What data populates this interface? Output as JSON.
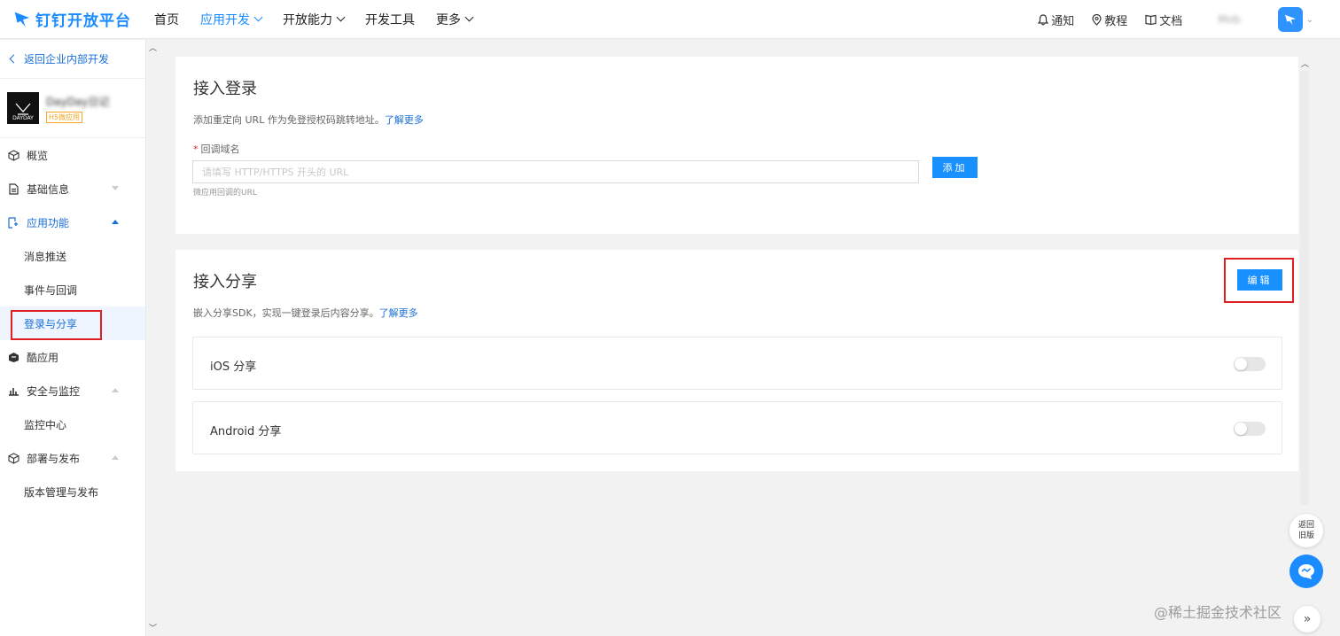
{
  "topbar": {
    "logo_text": "钉钉开放平台",
    "nav": [
      {
        "label": "首页",
        "has_menu": false,
        "active": false
      },
      {
        "label": "应用开发",
        "has_menu": true,
        "active": true
      },
      {
        "label": "开放能力",
        "has_menu": true,
        "active": false
      },
      {
        "label": "开发工具",
        "has_menu": false,
        "active": false
      },
      {
        "label": "更多",
        "has_menu": true,
        "active": false
      }
    ],
    "notify_label": "通知",
    "tutorial_label": "教程",
    "docs_label": "文档",
    "user_name": "Mob"
  },
  "sidebar": {
    "back_label": "返回企业内部开发",
    "app": {
      "name": "DayDay日记",
      "tag": "H5微应用",
      "logo_text": "DAYDAY"
    },
    "items": [
      {
        "label": "概览",
        "type": "top",
        "icon": "cube-icon"
      },
      {
        "label": "基础信息",
        "type": "top",
        "icon": "document-icon",
        "caret": "down"
      },
      {
        "label": "应用功能",
        "type": "top",
        "icon": "app-function-icon",
        "caret": "up",
        "expanded": true
      },
      {
        "label": "消息推送",
        "type": "sub"
      },
      {
        "label": "事件与回调",
        "type": "sub"
      },
      {
        "label": "登录与分享",
        "type": "sub",
        "selected": true
      },
      {
        "label": "酷应用",
        "type": "top",
        "icon": "cool-app-icon"
      },
      {
        "label": "安全与监控",
        "type": "top",
        "icon": "bar-chart-icon",
        "caret": "up"
      },
      {
        "label": "监控中心",
        "type": "sub"
      },
      {
        "label": "部署与发布",
        "type": "top",
        "icon": "box-icon",
        "caret": "up"
      },
      {
        "label": "版本管理与发布",
        "type": "sub"
      }
    ]
  },
  "login": {
    "title": "接入登录",
    "desc": "添加重定向 URL 作为免登授权码跳转地址。",
    "learn_more": "了解更多",
    "required_mark": "*",
    "field_label": "回调域名",
    "input_placeholder": "请填写 HTTP/HTTPS 开头的 URL",
    "input_value": "",
    "help": "微应用回调的URL",
    "add_button": "添加"
  },
  "share": {
    "title": "接入分享",
    "desc": "嵌入分享SDK，实现一键登录后内容分享。",
    "learn_more": "了解更多",
    "edit_button": "编辑",
    "rows": [
      {
        "label": "iOS 分享",
        "enabled": false
      },
      {
        "label": "Android 分享",
        "enabled": false
      }
    ]
  },
  "floating": {
    "old_version": "返回旧版",
    "expand": "»"
  },
  "watermark": "@稀土掘金技术社区",
  "colors": {
    "accent": "#1890ff",
    "highlight_box": "#e02020"
  }
}
